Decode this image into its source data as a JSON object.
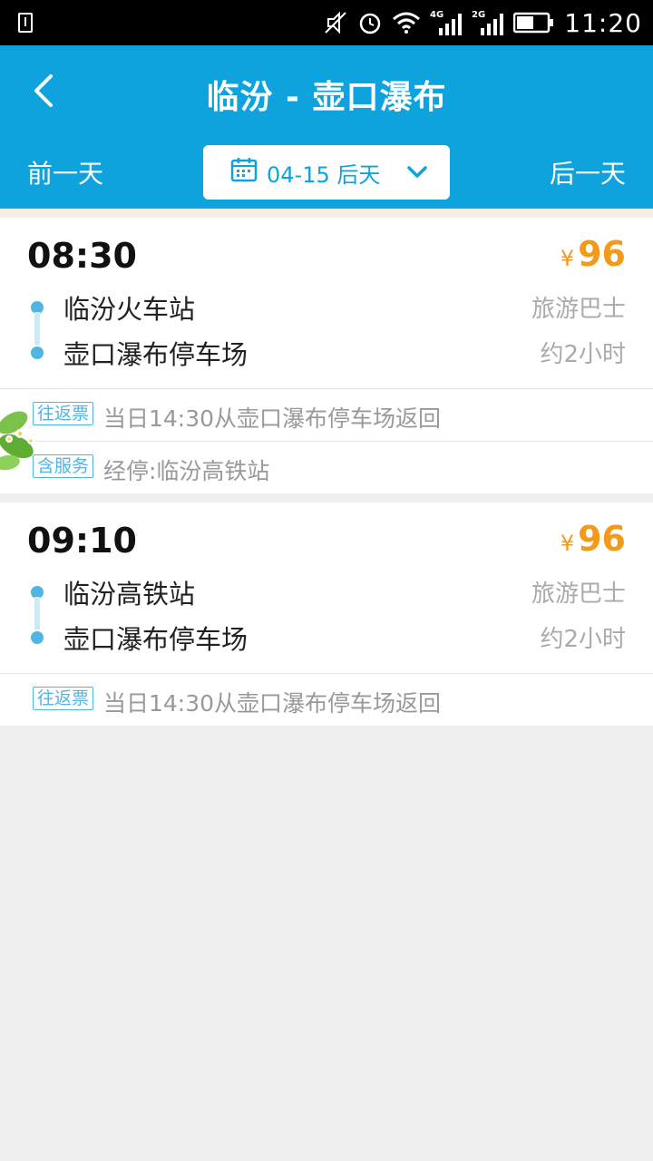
{
  "status_bar": {
    "time": "11:20",
    "net1": "4G",
    "net2": "2G"
  },
  "header": {
    "title": "临汾 - 壶口瀑布",
    "prev_day": "前一天",
    "next_day": "后一天",
    "date": "04-15 后天",
    "accent_color": "#0ea3dd"
  },
  "trips": [
    {
      "time": "08:30",
      "currency": "¥",
      "price": "96",
      "from": "临汾火车站",
      "to": "壶口瀑布停车场",
      "bus_type": "旅游巴士",
      "duration": "约2小时",
      "tags": [
        {
          "label": "往返票",
          "text": "当日14:30从壶口瀑布停车场返回"
        },
        {
          "label": "含服务",
          "text": "经停:临汾高铁站"
        }
      ]
    },
    {
      "time": "09:10",
      "currency": "¥",
      "price": "96",
      "from": "临汾高铁站",
      "to": "壶口瀑布停车场",
      "bus_type": "旅游巴士",
      "duration": "约2小时",
      "tags": [
        {
          "label": "往返票",
          "text": "当日14:30从壶口瀑布停车场返回"
        }
      ]
    }
  ],
  "colors": {
    "price": "#f39a1a",
    "tag": "#4fb6e3"
  }
}
